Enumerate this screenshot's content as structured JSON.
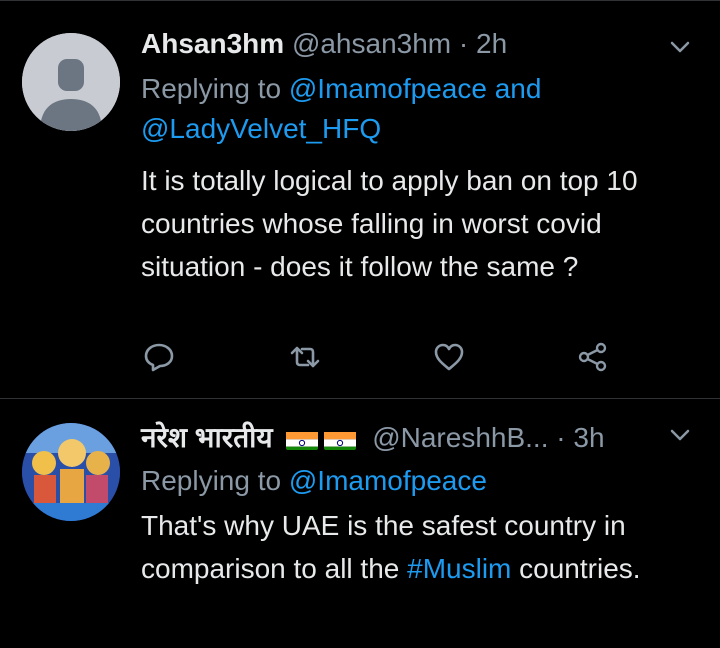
{
  "tweets": [
    {
      "name": "Ahsan3hm",
      "handle": "@ahsan3hm",
      "dot": "·",
      "time": "2h",
      "reply_prefix": "Replying to",
      "reply_user1": "@Imamofpeace",
      "reply_and": "and",
      "reply_user2": "@LadyVelvet_HFQ",
      "text": "It is totally logical to apply ban on top 10 countries whose falling in worst covid situation - does it follow the same ?"
    },
    {
      "name": "नरेश भारतीय",
      "handle": "@NareshhB...",
      "dot": "·",
      "time": "3h",
      "reply_prefix": "Replying to",
      "reply_user1": "@Imamofpeace",
      "text_before": "That's why UAE is the safest country in comparison to all the",
      "hashtag": "#Muslim",
      "text_after": "countries."
    }
  ],
  "icons": {
    "reply": "reply-icon",
    "retweet": "retweet-icon",
    "like": "heart-icon",
    "share": "share-icon",
    "chevron": "chevron-down-icon",
    "flag": "india-flag-icon"
  },
  "colors": {
    "background": "#000000",
    "text": "#e7e9ea",
    "muted": "#8b98a5",
    "link": "#1d9bf0",
    "divider": "#2f3336"
  }
}
